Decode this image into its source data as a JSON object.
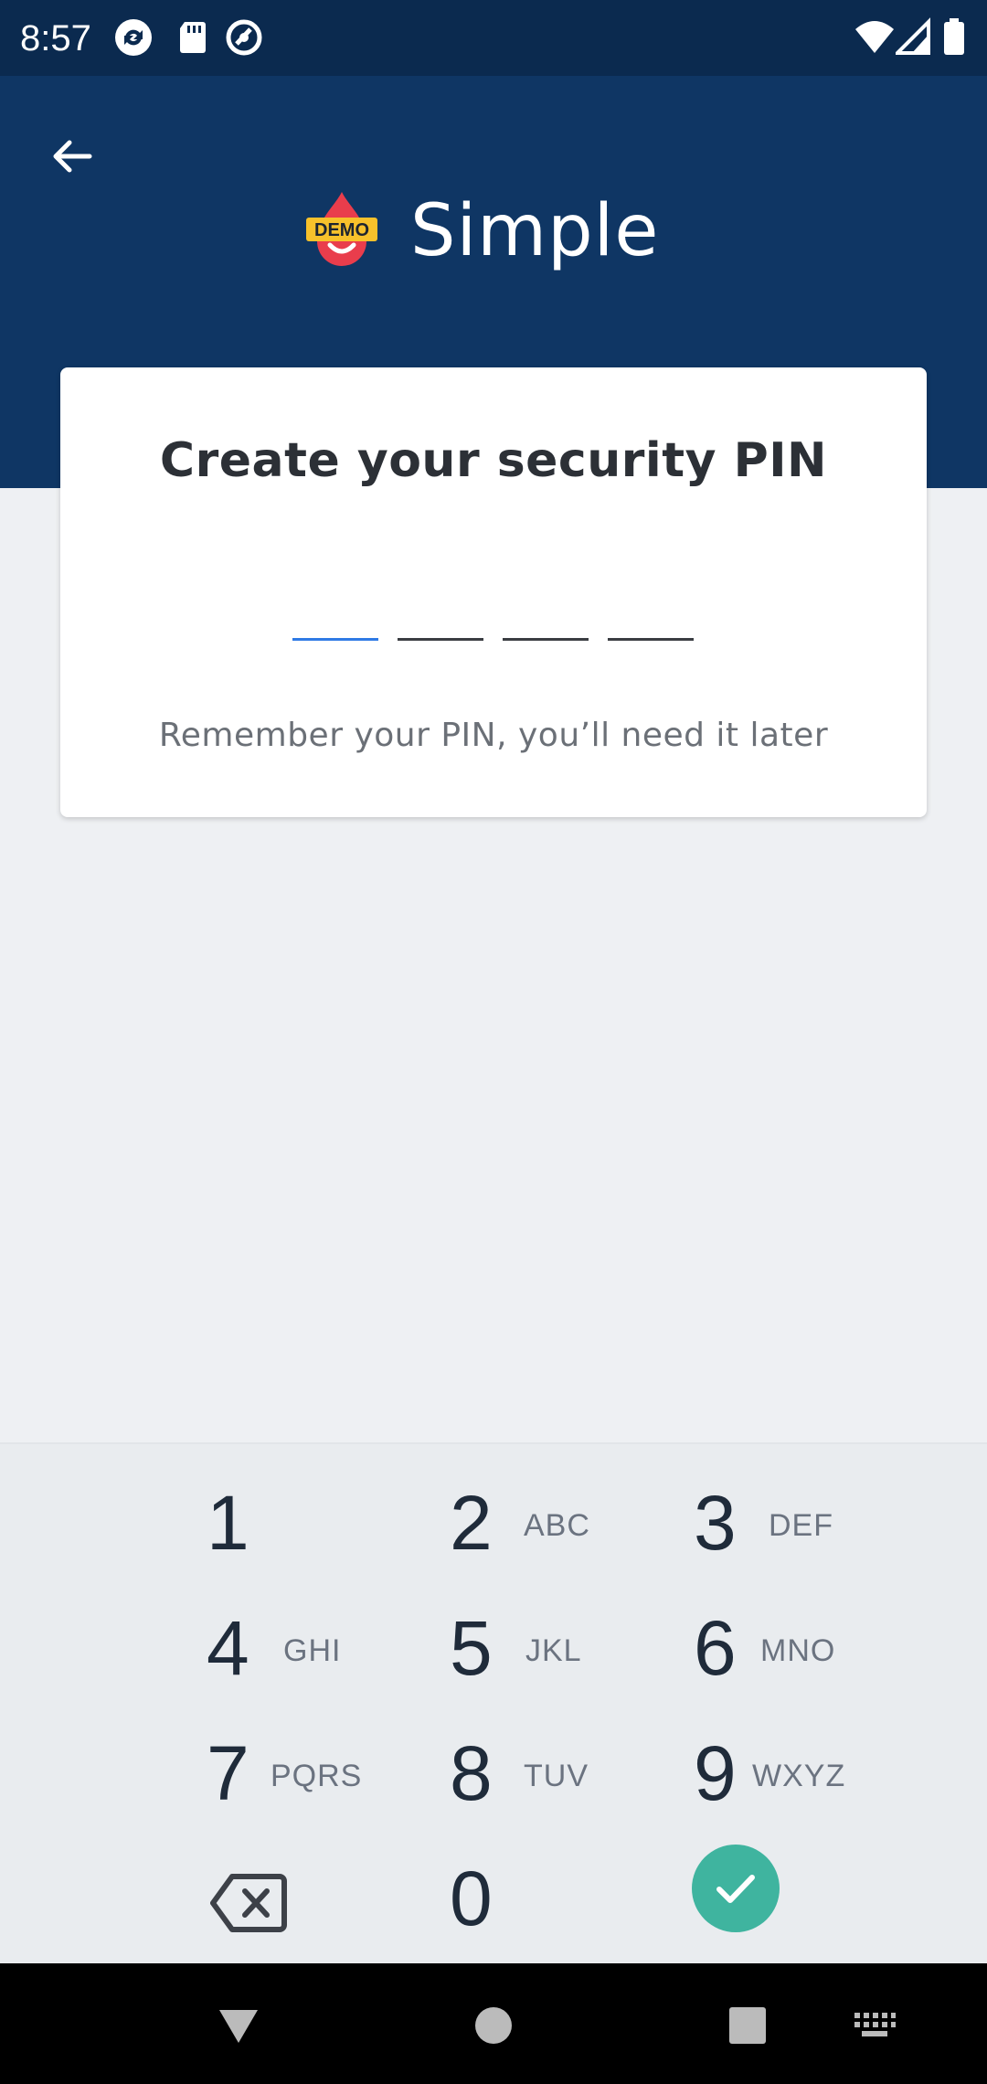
{
  "status_bar": {
    "time": "8:57",
    "left_icons": [
      "sync-icon",
      "sd-card-icon",
      "vpn-icon"
    ],
    "right_icons": [
      "wifi-icon",
      "signal-icon",
      "battery-icon"
    ]
  },
  "header": {
    "back_icon": "arrow-left-icon",
    "logo_badge": "DEMO",
    "app_name": "Simple",
    "background_color": "#0f3664"
  },
  "card": {
    "title": "Create your security PIN",
    "pin_length": 4,
    "hint": "Remember your PIN, you’ll need it later",
    "accent_color": "#2f7ae5"
  },
  "keypad": {
    "keys": [
      {
        "digit": "1",
        "letters": ""
      },
      {
        "digit": "2",
        "letters": "ABC"
      },
      {
        "digit": "3",
        "letters": "DEF"
      },
      {
        "digit": "4",
        "letters": "GHI"
      },
      {
        "digit": "5",
        "letters": "JKL"
      },
      {
        "digit": "6",
        "letters": "MNO"
      },
      {
        "digit": "7",
        "letters": "PQRS"
      },
      {
        "digit": "8",
        "letters": "TUV"
      },
      {
        "digit": "9",
        "letters": "WXYZ"
      },
      {
        "digit": "0",
        "letters": ""
      }
    ],
    "backspace_icon": "backspace-icon",
    "confirm_icon": "check-icon",
    "confirm_color": "#3fb49f"
  },
  "nav_bar": {
    "buttons": [
      "back-triangle-icon",
      "home-circle-icon",
      "recents-square-icon",
      "keyboard-icon"
    ]
  }
}
